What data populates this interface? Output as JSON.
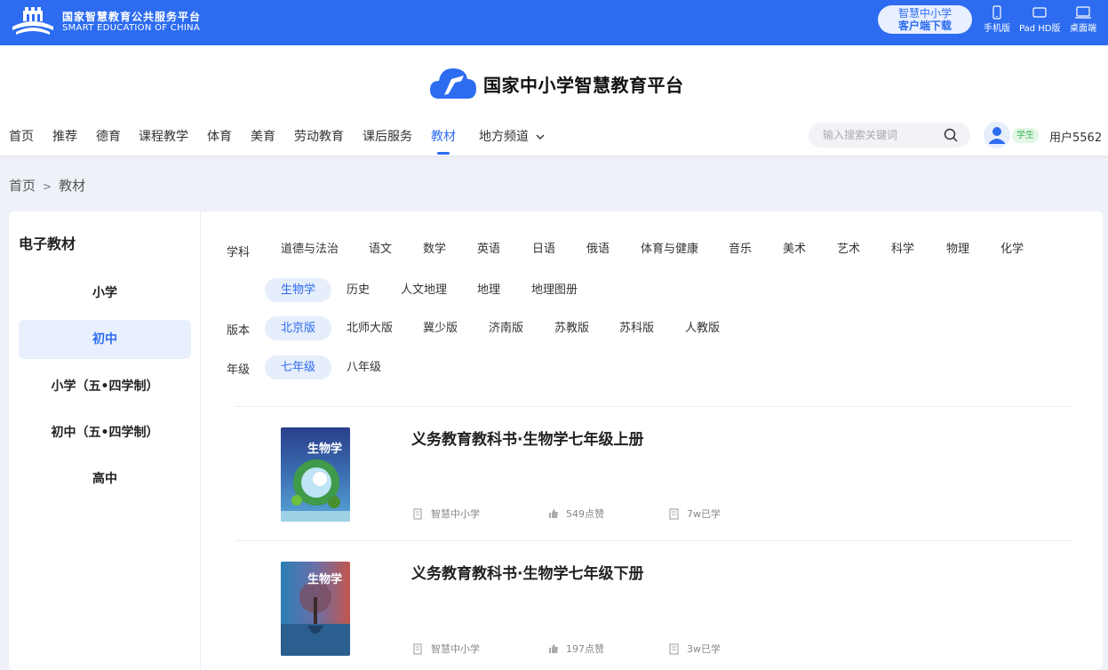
{
  "topbar": {
    "name_cn": "国家智慧教育公共服务平台",
    "name_en": "SMART EDUCATION OF CHINA",
    "download_line1": "智慧中小学",
    "download_line2": "客户端下载",
    "devices": [
      {
        "label": "手机版",
        "icon": "phone-icon"
      },
      {
        "label": "Pad HD版",
        "icon": "tablet-icon"
      },
      {
        "label": "桌面端",
        "icon": "desktop-icon"
      }
    ]
  },
  "brand": {
    "title": "国家中小学智慧教育平台"
  },
  "nav": {
    "items": [
      "首页",
      "推荐",
      "德育",
      "课程教学",
      "体育",
      "美育",
      "劳动教育",
      "课后服务",
      "教材",
      "地方频道"
    ],
    "active": "教材"
  },
  "search": {
    "placeholder": "输入搜索关键词"
  },
  "user": {
    "role": "学生",
    "name": "用户5562"
  },
  "breadcrumb": {
    "home": "首页",
    "sep": ">",
    "current": "教材"
  },
  "sidebar": {
    "title": "电子教材",
    "items": [
      "小学",
      "初中",
      "小学（五•四学制）",
      "初中（五•四学制）",
      "高中"
    ],
    "active": "初中"
  },
  "filters": {
    "subject_label": "学科",
    "subjects_row1": [
      "道德与法治",
      "语文",
      "数学",
      "英语",
      "日语",
      "俄语",
      "体育与健康",
      "音乐",
      "美术",
      "艺术",
      "科学",
      "物理",
      "化学"
    ],
    "subjects_row2": [
      "生物学",
      "历史",
      "人文地理",
      "地理",
      "地理图册"
    ],
    "subject_selected": "生物学",
    "edition_label": "版本",
    "editions": [
      "北京版",
      "北师大版",
      "冀少版",
      "济南版",
      "苏教版",
      "苏科版",
      "人教版"
    ],
    "edition_selected": "北京版",
    "grade_label": "年级",
    "grades": [
      "七年级",
      "八年级"
    ],
    "grade_selected": "七年级"
  },
  "books": [
    {
      "title": "义务教育教科书·生物学七年级上册",
      "publisher": "智慧中小学",
      "likes": "549点赞",
      "learned": "7w已学",
      "cover_text": "生物学"
    },
    {
      "title": "义务教育教科书·生物学七年级下册",
      "publisher": "智慧中小学",
      "likes": "197点赞",
      "learned": "3w已学",
      "cover_text": "生物学"
    }
  ],
  "colors": {
    "primary": "#2d6cf0",
    "active_bg": "#e6edfb",
    "badge_green": "#3bb55b"
  }
}
